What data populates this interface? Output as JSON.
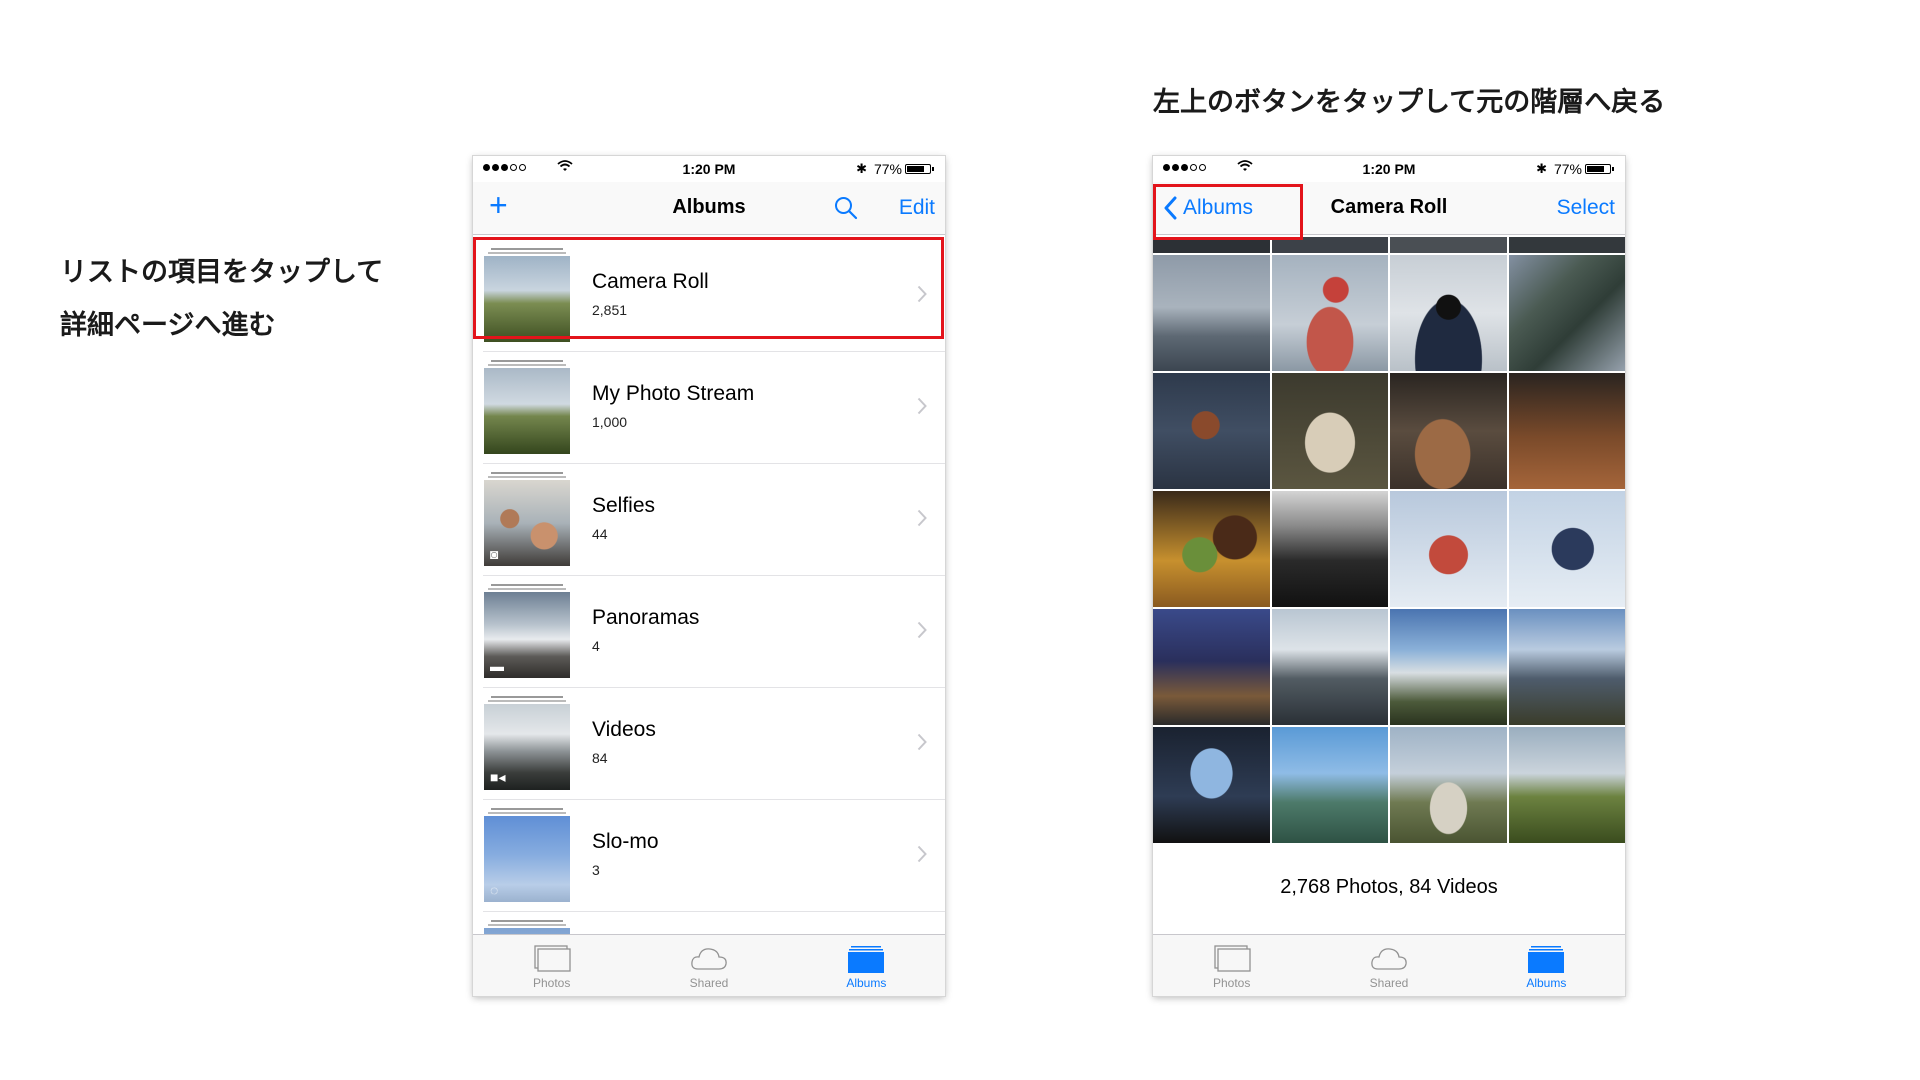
{
  "captions": {
    "left_line1": "リストの項目をタップして",
    "left_line2": "詳細ページへ進む",
    "right": "左上のボタンをタップして元の階層へ戻る"
  },
  "colors": {
    "accent": "#0a7aff",
    "highlight": "#e3141b",
    "tab_inactive": "#929292"
  },
  "status_bar": {
    "time": "1:20 PM",
    "battery": "77%",
    "battery_level": 0.77
  },
  "albums_screen": {
    "title": "Albums",
    "add_icon": "plus-icon",
    "search_icon": "search-icon",
    "edit_label": "Edit",
    "albums": [
      {
        "title": "Camera Roll",
        "count": "2,851",
        "badge": ""
      },
      {
        "title": "My Photo Stream",
        "count": "1,000",
        "badge": ""
      },
      {
        "title": "Selfies",
        "count": "44",
        "badge": "camera-icon"
      },
      {
        "title": "Panoramas",
        "count": "4",
        "badge": "panorama-icon"
      },
      {
        "title": "Videos",
        "count": "84",
        "badge": "video-camera-icon"
      },
      {
        "title": "Slo-mo",
        "count": "3",
        "badge": "slomo-icon"
      }
    ]
  },
  "camera_roll_screen": {
    "back_label": "Albums",
    "title": "Camera Roll",
    "select_label": "Select",
    "summary": "2,768 Photos, 84 Videos"
  },
  "tab_bar": {
    "tabs": [
      {
        "label": "Photos",
        "icon": "photos-icon"
      },
      {
        "label": "Shared",
        "icon": "cloud-icon"
      },
      {
        "label": "Albums",
        "icon": "albums-icon"
      }
    ],
    "active_index": 2
  }
}
